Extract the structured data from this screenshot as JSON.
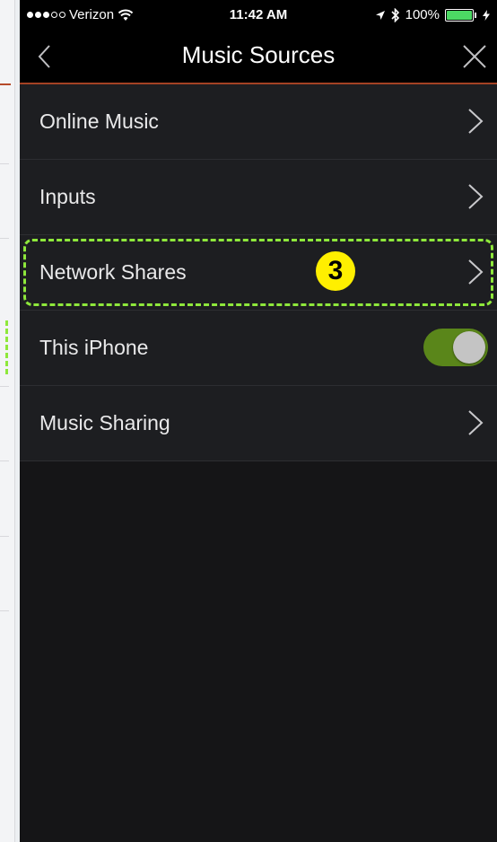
{
  "statusbar": {
    "carrier": "Verizon",
    "time": "11:42 AM",
    "battery_percent": "100%",
    "signal_icons": [
      "signal-dot",
      "signal-dot",
      "signal-dot",
      "signal-empty",
      "signal-empty"
    ]
  },
  "navbar": {
    "title": "Music Sources"
  },
  "rows": [
    {
      "label": "Online Music"
    },
    {
      "label": "Inputs"
    },
    {
      "label": "Network Shares",
      "step_badge": "3"
    },
    {
      "label": "This iPhone",
      "toggle_on": true
    },
    {
      "label": "Music Sharing"
    }
  ],
  "colors": {
    "accent": "#a44224",
    "toggle_on": "#5a861a",
    "highlight": "#8ee83b",
    "badge": "#ffef00"
  }
}
